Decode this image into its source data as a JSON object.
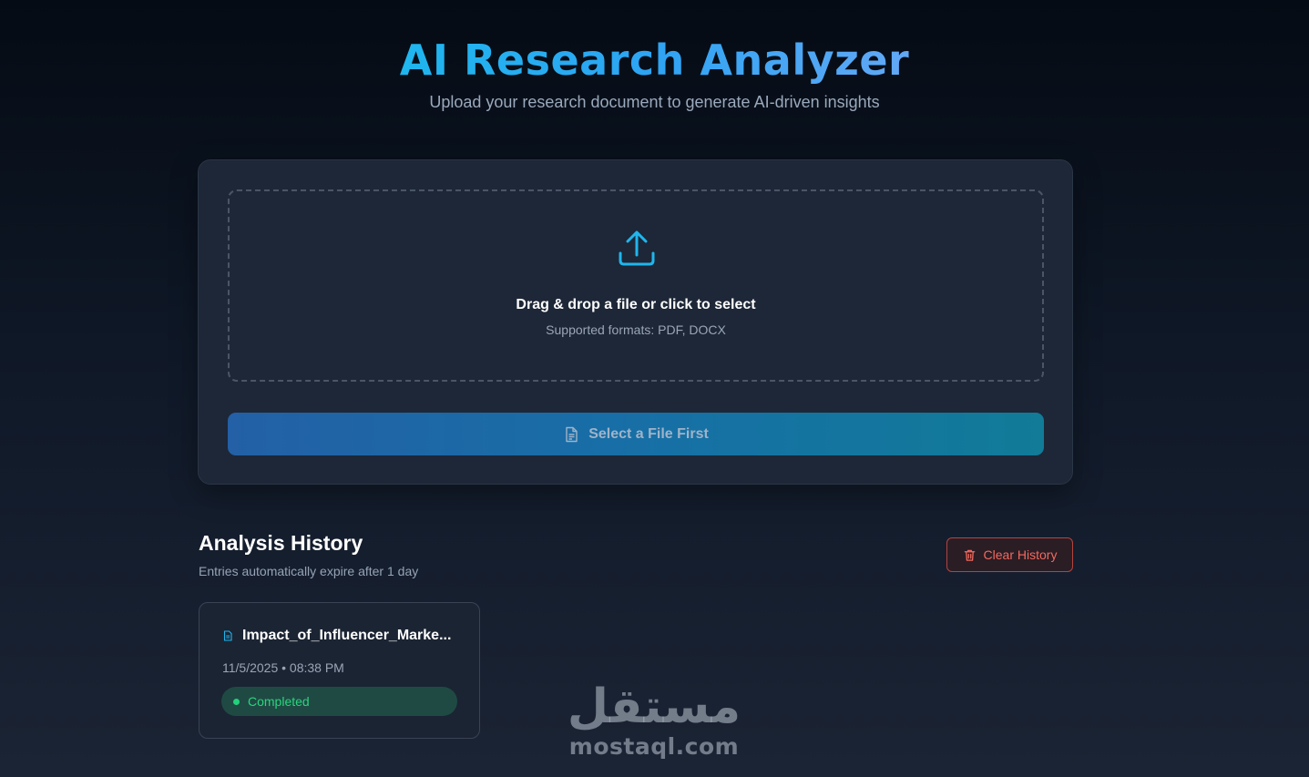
{
  "header": {
    "title": "AI Research Analyzer",
    "subtitle": "Upload your research document to generate AI-driven insights"
  },
  "upload": {
    "icon": "upload-icon",
    "drop_title": "Drag & drop a file or click to select",
    "formats": "Supported formats: PDF, DOCX",
    "button_icon": "document-icon",
    "button_label": "Select a File First"
  },
  "history": {
    "title": "Analysis History",
    "subtitle": "Entries automatically expire after 1 day",
    "clear_icon": "trash-icon",
    "clear_label": "Clear History",
    "items": [
      {
        "icon": "file-icon",
        "filename": "Impact_of_Influencer_Marke...",
        "timestamp": "11/5/2025 • 08:38 PM",
        "status": "Completed",
        "status_color": "#22d17b"
      }
    ]
  },
  "watermark": {
    "arabic": "مستقل",
    "latin": "mostaql.com"
  },
  "colors": {
    "accent": "#1fb6ee",
    "danger": "#f2695f",
    "success": "#22d17b"
  }
}
